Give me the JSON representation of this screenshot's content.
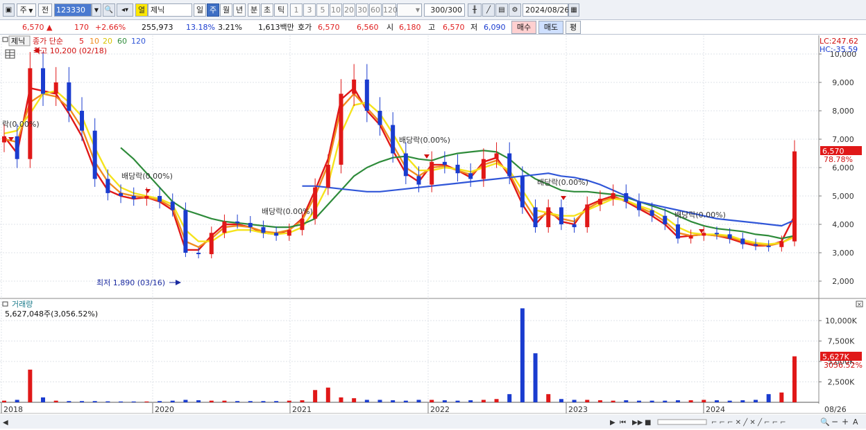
{
  "toolbar": {
    "market": "주",
    "prev": "전",
    "code": "123330",
    "mode_badge": "열",
    "stock_name": "제닉",
    "periods": [
      "일",
      "주",
      "월",
      "년",
      "분",
      "초",
      "틱"
    ],
    "active_period": "주",
    "intervals": [
      "1",
      "3",
      "5",
      "10",
      "20",
      "30",
      "60",
      "120"
    ],
    "count": "300",
    "count_total": "/300",
    "date": "2024/08/26"
  },
  "quote": {
    "price": "6,570",
    "change_arrow": "▲",
    "change": "170",
    "change_pct": "+2.66%",
    "volume": "255,973",
    "turnover_rate": "13.18%",
    "ratio": "3.21%",
    "amount": "1,613백만",
    "hoga_label": "호가",
    "ask": "6,570",
    "bid": "6,560",
    "open_label": "시",
    "open": "6,180",
    "high_label": "고",
    "high": "6,570",
    "low_label": "저",
    "low": "6,090",
    "buy_label": "매수",
    "sell_label": "매도",
    "avg_label": "평"
  },
  "price_panel": {
    "tab": "제닉",
    "legend_prefix": "종가 단순",
    "ma_periods": [
      "5",
      "10",
      "20",
      "60",
      "120"
    ],
    "ma_colors": [
      "#e01818",
      "#f08c1e",
      "#f5e31c",
      "#2e8b3a",
      "#3056d8"
    ],
    "high_note": "최고 10,200 (02/18)",
    "low_note": "최저 1,890 (03/16)",
    "lc": "LC:247.62",
    "hc": "HC:-35.59",
    "last_price_tag": "6,570",
    "last_pct_tag": "78.78%",
    "dividend_label": "배당락(0.00%)",
    "dividend_label_cut": "락(0.00%)"
  },
  "volume_panel": {
    "title": "거래량",
    "summary": "5,627,048주(3,056.52%)",
    "last_volume_tag": "5,627K",
    "last_pct_tag": "3056.52%"
  },
  "x_axis": {
    "years": [
      "2018",
      "2020",
      "2021",
      "2022",
      "2023",
      "2024"
    ],
    "last_date": "08/26"
  },
  "chart_data": [
    {
      "type": "candlestick",
      "title": "",
      "ylim": [
        1400,
        10400
      ],
      "y_ticks": [
        "2,000",
        "3,000",
        "4,000",
        "5,000",
        "6,000",
        "7,000",
        "8,000",
        "9,000",
        "10,000"
      ],
      "x_labels": [
        "2018",
        "2020",
        "2021",
        "2022",
        "2023",
        "2024"
      ],
      "series": [
        {
          "name": "종가",
          "close": [
            7100,
            6300,
            9500,
            8600,
            9000,
            8000,
            7300,
            5600,
            5100,
            5000,
            4900,
            5000,
            4800,
            4500,
            3000,
            2950,
            3700,
            4100,
            4050,
            3900,
            3700,
            3600,
            3800,
            4200,
            5300,
            6100,
            8600,
            9100,
            8000,
            7500,
            6500,
            5700,
            5400,
            6200,
            6100,
            5800,
            5600,
            6300,
            6500,
            5700,
            4600,
            3900,
            4600,
            4000,
            3900,
            4700,
            4900,
            5100,
            4800,
            4500,
            4300,
            4000,
            3500,
            3600,
            3700,
            3650,
            3500,
            3300,
            3250,
            3200,
            3400,
            6570
          ]
        },
        {
          "name": "5",
          "values": [
            7100,
            6500,
            8800,
            8700,
            8600,
            7900,
            7100,
            5900,
            5200,
            5000,
            4900,
            4950,
            4800,
            4500,
            3100,
            3100,
            3600,
            4000,
            4000,
            3900,
            3700,
            3650,
            3800,
            4200,
            5200,
            6300,
            8400,
            8800,
            8000,
            7500,
            6600,
            5800,
            5500,
            6100,
            6100,
            5900,
            5650,
            6200,
            6350,
            5700,
            4700,
            4000,
            4500,
            4100,
            4000,
            4650,
            4850,
            5000,
            4800,
            4550,
            4300,
            4000,
            3550,
            3600,
            3650,
            3600,
            3500,
            3350,
            3250,
            3250,
            3400,
            4300
          ]
        },
        {
          "name": "10",
          "values": [
            7000,
            6900,
            8300,
            8600,
            8500,
            8100,
            7400,
            6200,
            5500,
            5100,
            5000,
            4950,
            4850,
            4600,
            3400,
            3200,
            3500,
            3900,
            3950,
            3900,
            3750,
            3700,
            3800,
            4150,
            5000,
            6100,
            8100,
            8600,
            8100,
            7600,
            6800,
            6000,
            5700,
            6000,
            6050,
            5900,
            5750,
            6100,
            6250,
            5800,
            4900,
            4200,
            4400,
            4200,
            4100,
            4550,
            4800,
            4950,
            4850,
            4600,
            4400,
            4100,
            3700,
            3600,
            3650,
            3600,
            3550,
            3400,
            3300,
            3250,
            3350,
            3600
          ]
        },
        {
          "name": "20",
          "values": [
            7200,
            7300,
            7900,
            8600,
            8700,
            8300,
            7800,
            6700,
            5800,
            5300,
            5100,
            5000,
            4900,
            4700,
            3800,
            3400,
            3400,
            3700,
            3800,
            3800,
            3700,
            3650,
            3700,
            3900,
            4500,
            5400,
            7200,
            8200,
            8300,
            7900,
            7200,
            6400,
            5900,
            5900,
            6000,
            5950,
            5850,
            6000,
            6150,
            5900,
            5200,
            4500,
            4400,
            4300,
            4300,
            4500,
            4700,
            4900,
            4850,
            4650,
            4500,
            4250,
            3900,
            3700,
            3650,
            3650,
            3600,
            3450,
            3350,
            3300,
            3350,
            3550
          ]
        },
        {
          "name": "60",
          "values": [
            null,
            null,
            null,
            null,
            null,
            null,
            null,
            null,
            null,
            6700,
            6300,
            5800,
            5300,
            4800,
            4500,
            4350,
            4200,
            4100,
            4050,
            4000,
            3950,
            3900,
            3900,
            4000,
            4200,
            4700,
            5200,
            5700,
            6000,
            6200,
            6350,
            6400,
            6300,
            6250,
            6400,
            6500,
            6550,
            6600,
            6550,
            6300,
            5900,
            5600,
            5400,
            5200,
            5150,
            5150,
            5100,
            5050,
            4950,
            4800,
            4650,
            4500,
            4300,
            4100,
            3950,
            3850,
            3800,
            3750,
            3650,
            3600,
            3500,
            3600
          ]
        },
        {
          "name": "120",
          "values": [
            null,
            null,
            null,
            null,
            null,
            null,
            null,
            null,
            null,
            null,
            null,
            null,
            null,
            null,
            null,
            null,
            null,
            null,
            null,
            null,
            null,
            null,
            null,
            5350,
            5350,
            5300,
            5250,
            5200,
            5150,
            5150,
            5200,
            5250,
            5300,
            5350,
            5400,
            5450,
            5500,
            5550,
            5600,
            5650,
            5700,
            5750,
            5800,
            5700,
            5650,
            5550,
            5400,
            5200,
            5000,
            4800,
            4700,
            4600,
            4500,
            4400,
            4300,
            4200,
            4150,
            4100,
            4050,
            4000,
            3950,
            4150
          ]
        }
      ]
    },
    {
      "type": "bar",
      "title": "거래량",
      "ylim": [
        0,
        12000
      ],
      "y_ticks": [
        "2,500K",
        "5,000K",
        "7,500K",
        "10,000K"
      ],
      "series": [
        {
          "name": "거래량",
          "unit": "K",
          "values": [
            200,
            300,
            4000,
            600,
            200,
            150,
            150,
            150,
            120,
            100,
            100,
            100,
            150,
            200,
            300,
            250,
            200,
            200,
            150,
            150,
            150,
            150,
            200,
            250,
            1500,
            1800,
            600,
            500,
            300,
            300,
            250,
            200,
            300,
            300,
            250,
            200,
            250,
            300,
            400,
            1000,
            11500,
            6000,
            1000,
            400,
            300,
            300,
            250,
            200,
            250,
            200,
            200,
            200,
            250,
            250,
            300,
            250,
            200,
            250,
            300,
            1000,
            1200,
            5627
          ]
        }
      ]
    }
  ]
}
